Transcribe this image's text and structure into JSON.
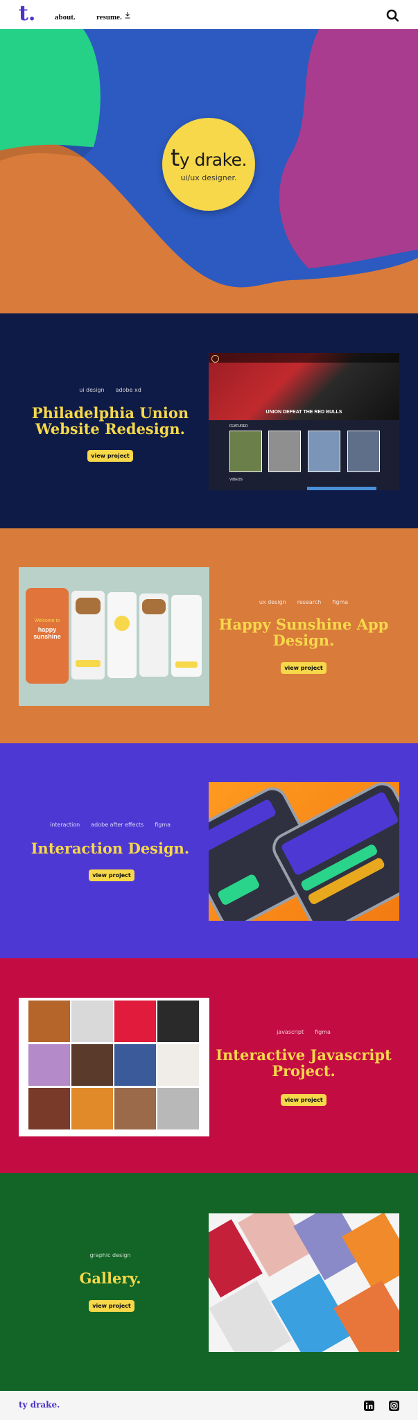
{
  "nav": {
    "logo": "t.",
    "about": "about.",
    "resume": "resume."
  },
  "hero": {
    "name_t": "t",
    "name_rest": "y drake.",
    "role": "ui/ux designer."
  },
  "projects": [
    {
      "tags": [
        "ui design",
        "adobe xd"
      ],
      "title": "Philadelphia Union Website Redesign.",
      "button": "view project",
      "shot_text": {
        "banner": "UNION DEFEAT THE RED BULLS",
        "featured": "FEATURED",
        "videos": "VIDEOS"
      }
    },
    {
      "tags": [
        "ux design",
        "research",
        "figma"
      ],
      "title": "Happy Sunshine App Design.",
      "button": "view project",
      "shot_text": {
        "welcome": "Welcome to",
        "app_name": "happy sunshine"
      }
    },
    {
      "tags": [
        "interaction",
        "adobe after effects",
        "figma"
      ],
      "title": "Interaction Design.",
      "button": "view project"
    },
    {
      "tags": [
        "javascript",
        "figma"
      ],
      "title": "Interactive Javascript Project.",
      "button": "view project"
    },
    {
      "tags": [
        "graphic design"
      ],
      "title": "Gallery.",
      "button": "view project"
    }
  ],
  "footer": {
    "name": "ty drake."
  },
  "colors": {
    "accent": "#f6d84a",
    "brand": "#4b35c9",
    "navy": "#0f1b47",
    "orange": "#d97b3b",
    "purple": "#4e38d3",
    "crimson": "#c30c42",
    "green": "#126526"
  }
}
